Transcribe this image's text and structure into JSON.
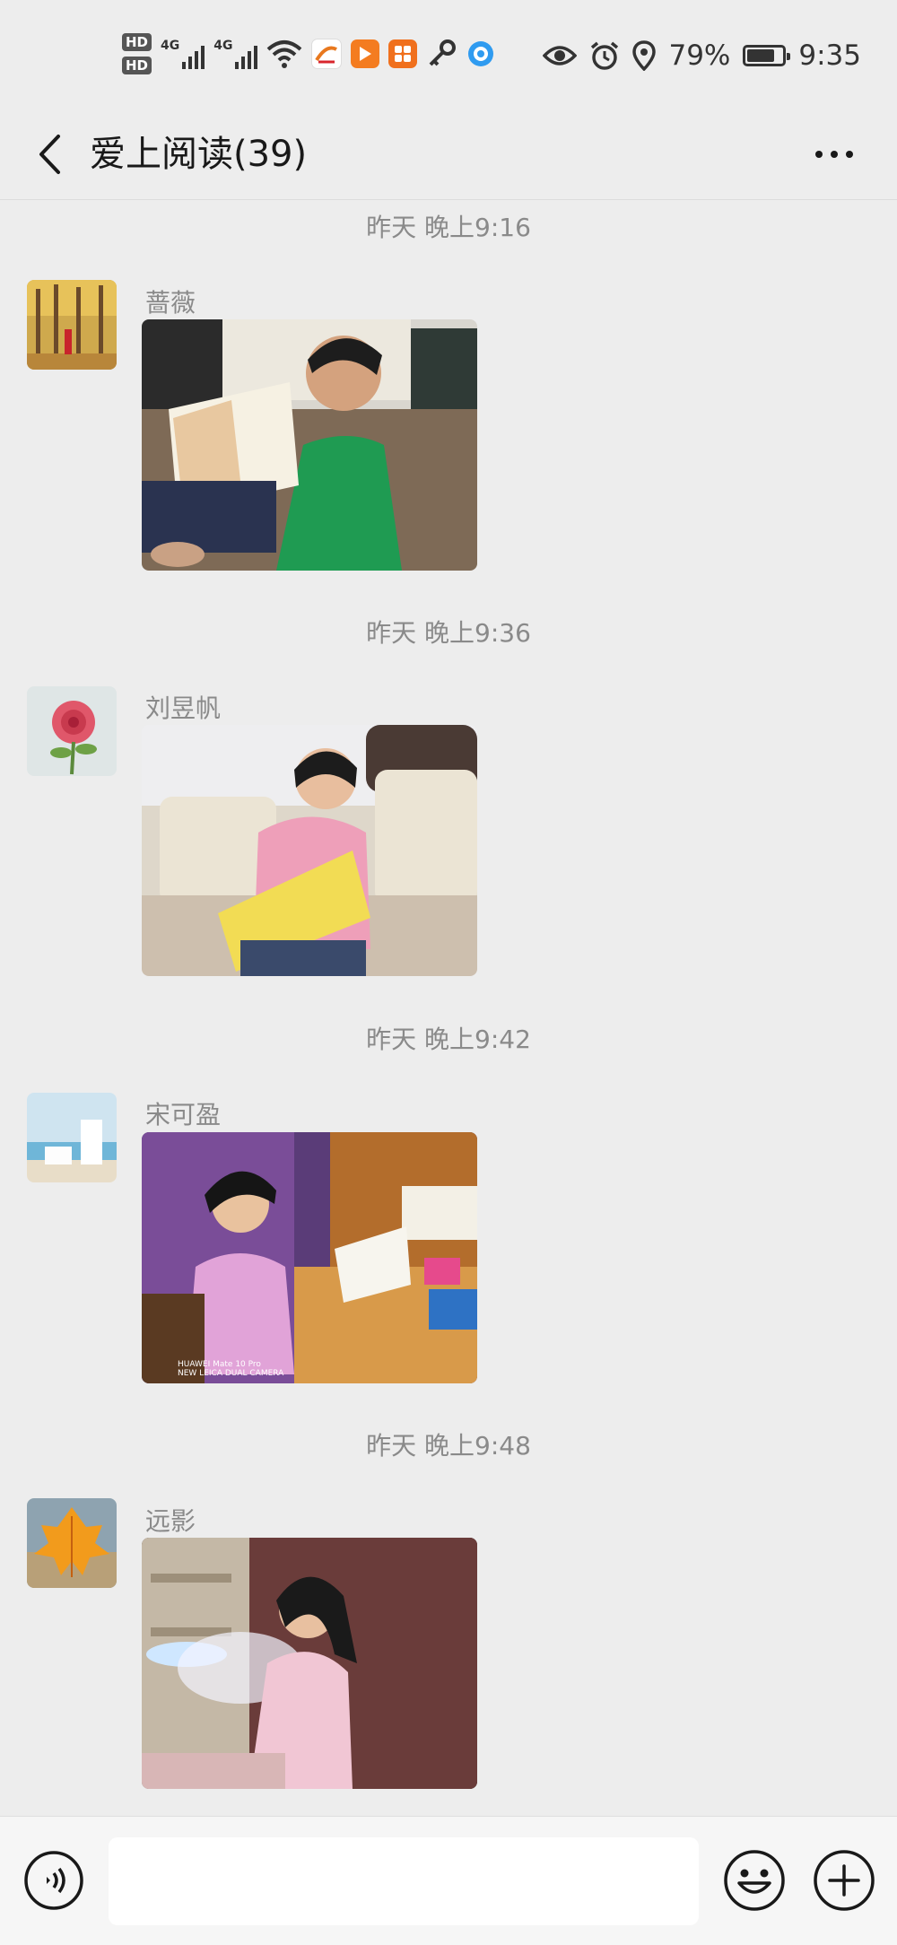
{
  "status_bar": {
    "hd1": "HD",
    "hd2": "HD",
    "net1": "4G",
    "net2": "4G",
    "battery_percent": "79%",
    "time": "9:35"
  },
  "header": {
    "title": "爱上阅读(39)"
  },
  "messages": [
    {
      "timestamp": "昨天 晚上9:16",
      "sender": "蔷薇"
    },
    {
      "timestamp": "昨天 晚上9:36",
      "sender": "刘昱帆"
    },
    {
      "timestamp": "昨天 晚上9:42",
      "sender": "宋可盈"
    },
    {
      "timestamp": "昨天 晚上9:48",
      "sender": "远影"
    }
  ],
  "photo_watermark": {
    "line1": "HUAWEI Mate 10 Pro",
    "line2": "NEW LEICA DUAL CAMERA"
  },
  "input": {
    "value": "",
    "placeholder": ""
  },
  "icons": {
    "back": "chevron-left-icon",
    "more": "more-dots-icon",
    "voice": "voice-icon",
    "emoji": "emoji-icon",
    "plus": "plus-icon"
  },
  "colors": {
    "background": "#ededed",
    "input_bar": "#f6f6f6",
    "timestamp_text": "#8a8a8a"
  }
}
